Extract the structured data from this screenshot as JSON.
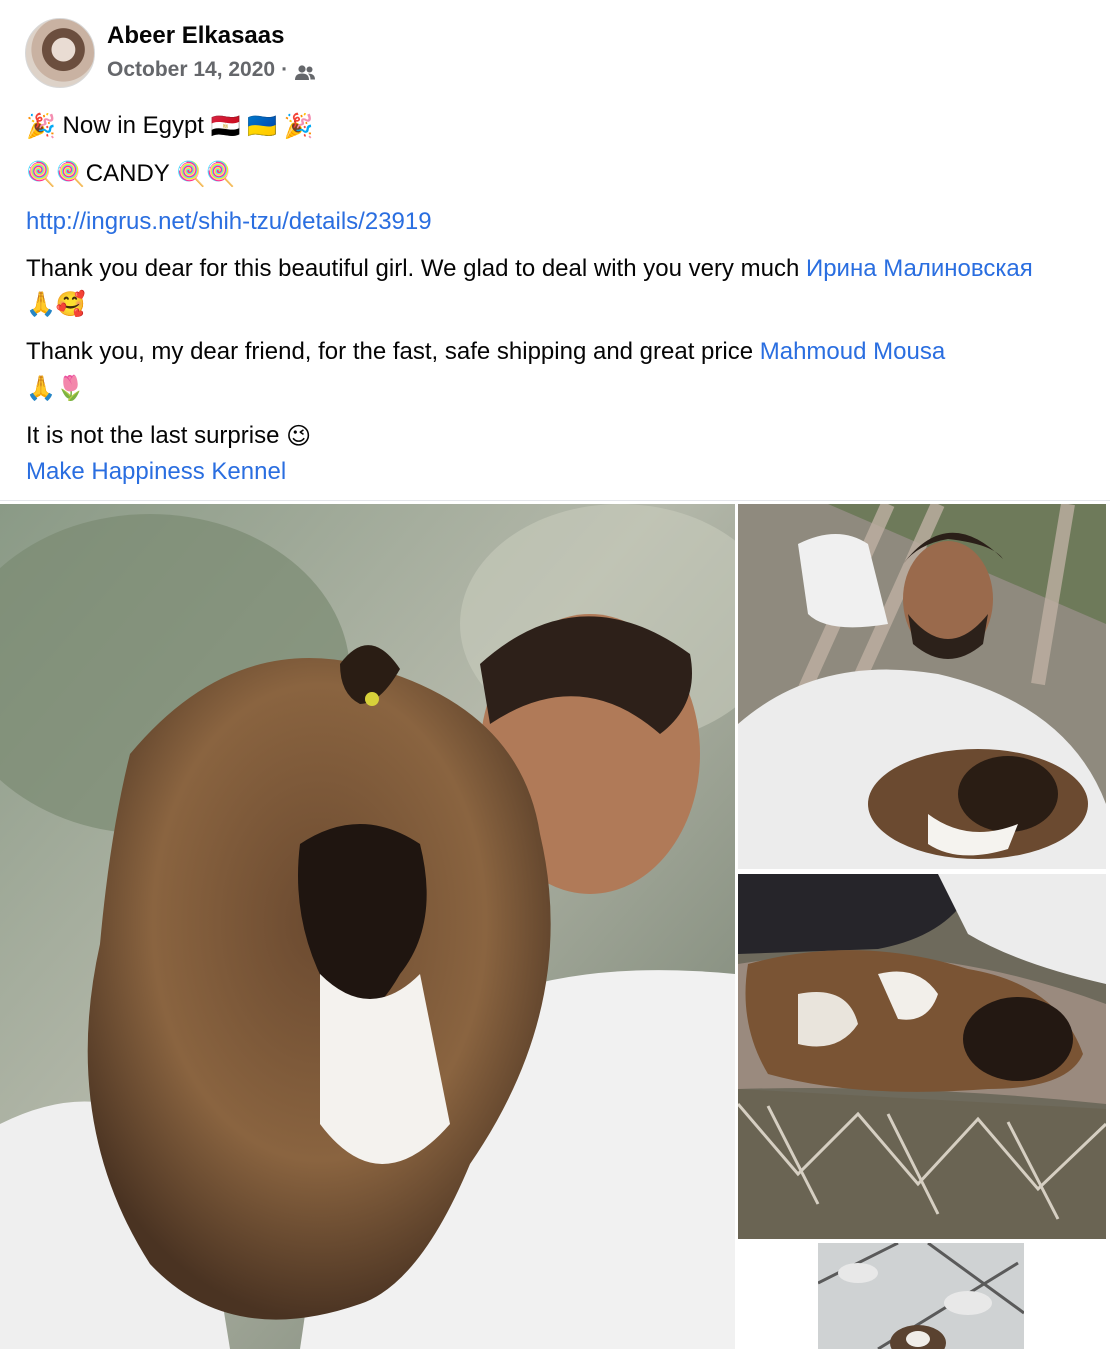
{
  "post": {
    "author": "Abeer Elkasaas",
    "date": "October 14, 2020",
    "separator": "·",
    "audience_icon": "friends-icon",
    "lines": {
      "l1_start_emoji": "🎉",
      "l1_text": " Now in Egypt ",
      "l1_flags": "🇪🇬 🇺🇦 🎉",
      "l2_emoji_before": "🍭🍭",
      "l2_text": "CANDY ",
      "l2_emoji_after": "🍭🍭",
      "l3_link": "http://ingrus.net/shih-tzu/details/23919",
      "l4_text": "Thank you dear for this beautiful girl. We glad to deal with you very much ",
      "l4_mention": "Ирина Малиновская",
      "l4_emoji": " 🙏🥰",
      "l5_text": "Thank you, my dear friend, for the fast, safe shipping and great price ",
      "l5_mention": "Mahmoud Mousa",
      "l5_emoji": "🙏🌷",
      "l6_text": "It is not the last surprise ",
      "l6_emoji": "😉",
      "l7_link": "Make Happiness Kennel"
    }
  },
  "photos": [
    {
      "name": "photo-man-holding-shih-tzu"
    },
    {
      "name": "photo-man-in-hammock-with-puppy"
    },
    {
      "name": "photo-puppy-sleeping-in-hammock"
    },
    {
      "name": "photo-puppy-on-tiles"
    }
  ],
  "colors": {
    "link": "#2a6ee0",
    "meta": "#65676b",
    "text": "#050505"
  }
}
